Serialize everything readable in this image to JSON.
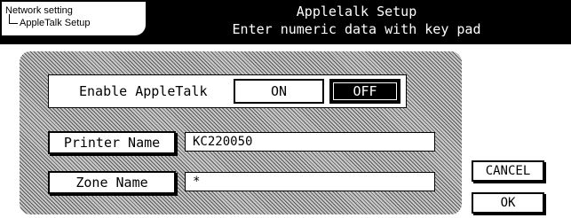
{
  "header": {
    "breadcrumb": {
      "level1": "Network setting",
      "level2": "AppleTalk Setup"
    },
    "title": "Applelalk Setup",
    "subtitle": "Enter numeric data with key pad"
  },
  "enable_appletalk": {
    "label": "Enable AppleTalk",
    "on_label": "ON",
    "off_label": "OFF",
    "selected": "OFF"
  },
  "printer_name": {
    "button_label": "Printer Name",
    "value": "KC220050"
  },
  "zone_name": {
    "button_label": "Zone Name",
    "value": "*"
  },
  "actions": {
    "cancel_label": "CANCEL",
    "ok_label": "OK"
  },
  "colors": {
    "header_background": "#000000",
    "selected_button": "#000000",
    "panel_hatch": "#9a9a9a"
  }
}
